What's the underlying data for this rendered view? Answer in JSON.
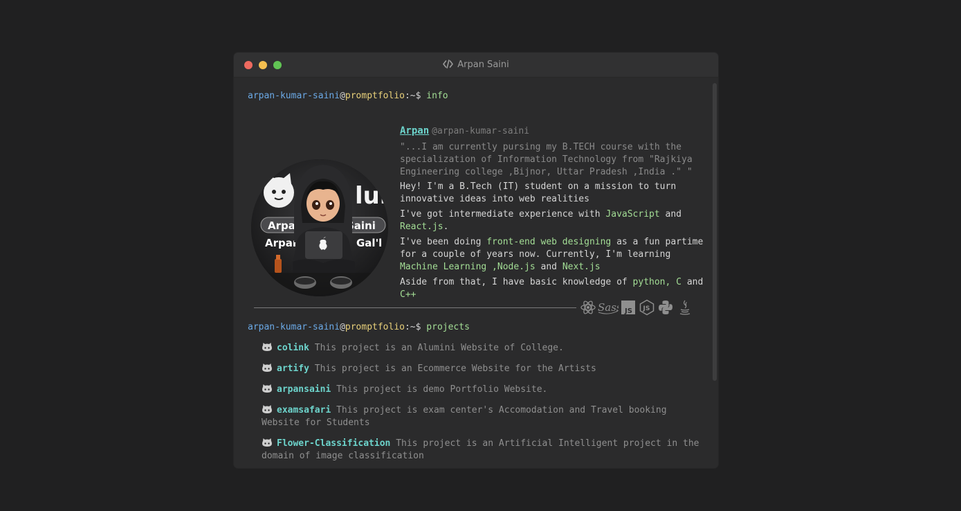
{
  "window": {
    "title": "Arpan Saini",
    "controls": {
      "close": "#ee6a5f",
      "minimize": "#f5bf4f",
      "maximize": "#61c554"
    }
  },
  "prompt": {
    "user": "arpan-kumar-saini",
    "at": "@",
    "host": "promptfolio",
    "path": ":~$ "
  },
  "commands": {
    "info": "info",
    "projects": "projects"
  },
  "avatar": {
    "icon": "hacker-avatar",
    "text_line1_a": "Arpan",
    "text_line1_b": "Saini",
    "text_line2_a": "Arpan",
    "text_line2_b": "Gal'l",
    "text_brand": "lub"
  },
  "bio": {
    "name": "Arpan",
    "handle": "@arpan-kumar-saini",
    "quote": "\"...I am currently pursing my B.TECH course with the specialization of Information Technology from \"Rajkiya Engineering college ,Bijnor, Uttar Pradesh ,India .\" \"",
    "p1": "Hey! I'm a B.Tech (IT) student on a mission to turn innovative ideas into web realities",
    "p2_a": "I've got intermediate experience with ",
    "p2_js": "JavaScript",
    "p2_b": " and ",
    "p2_react": "React.js",
    "p2_c": ".",
    "p3_a": "I've been doing ",
    "p3_fe": "front-end web designing",
    "p3_b": " as a fun partime for a couple of years now. Currently, I'm learning ",
    "p3_ml": "Machine Learning ,",
    "p3_node": "Node.js",
    "p3_c": " and ",
    "p3_next": "Next.js",
    "p4_a": "Aside from that, I have basic knowledge of ",
    "p4_py": "python, C",
    "p4_b": " and ",
    "p4_cpp": "C++"
  },
  "tech_icons": [
    "react-icon",
    "sass-icon",
    "js-icon",
    "nodejs-icon",
    "python-icon",
    "java-icon"
  ],
  "projects": [
    {
      "name": "colink",
      "desc": "This project is an Alumini Website of College."
    },
    {
      "name": "artify",
      "desc": "This project is an Ecommerce Website for the Artists"
    },
    {
      "name": "arpansaini",
      "desc": "This project is demo Portfolio Website."
    },
    {
      "name": "examsafari",
      "desc": "This project is exam center's Accomodation and Travel booking Website for Students"
    },
    {
      "name": "Flower-Classification",
      "desc": "This project is an Artificial Intelligent project in the domain of image classification"
    }
  ],
  "colors": {
    "background": "#202021",
    "window": "#2b2b2c",
    "prompt_user": "#6ba9e6",
    "prompt_host": "#e8d07a",
    "command": "#a3dd95",
    "accent": "#6dd4cc"
  }
}
